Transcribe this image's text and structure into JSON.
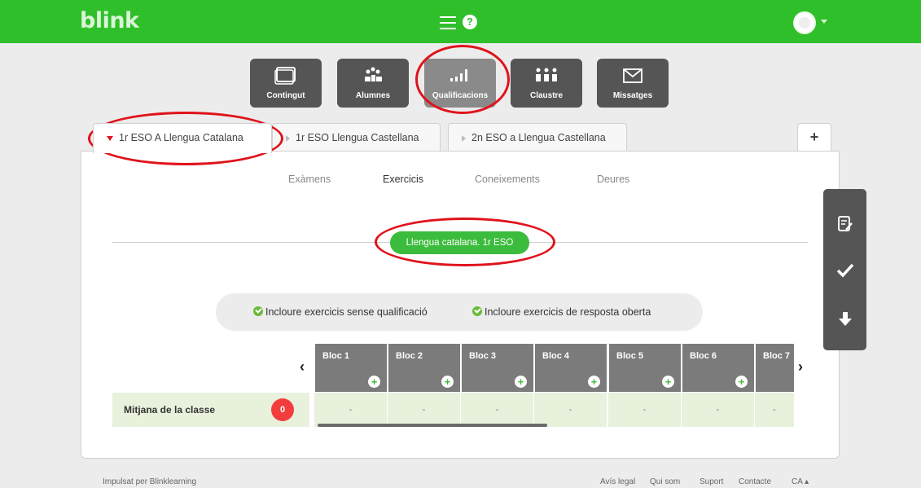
{
  "app": {
    "logo": "blink"
  },
  "modules": [
    {
      "label": "Contingut",
      "icon": "monitor-icon"
    },
    {
      "label": "Alumnes",
      "icon": "students-icon"
    },
    {
      "label": "Qualificacions",
      "icon": "bar-chart-icon",
      "active": true
    },
    {
      "label": "Claustre",
      "icon": "teachers-icon"
    },
    {
      "label": "Missatges",
      "icon": "envelope-icon"
    }
  ],
  "tabs": [
    {
      "label": "1r ESO A Llengua Catalana",
      "active": true
    },
    {
      "label": "1r ESO Llengua Castellana"
    },
    {
      "label": "2n ESO a Llengua Castellana"
    }
  ],
  "tab_add_label": "+",
  "subtabs": [
    {
      "label": "Exàmens"
    },
    {
      "label": "Exercicis",
      "active": true
    },
    {
      "label": "Coneixements"
    },
    {
      "label": "Deures"
    }
  ],
  "course_pill": "Llengua catalana. 1r ESO",
  "filters": [
    {
      "label": "Incloure exercicis sense qualificació",
      "checked": true
    },
    {
      "label": "Incloure exercicis de resposta oberta",
      "checked": true
    }
  ],
  "grid": {
    "blocs": [
      "Bloc 1",
      "Bloc 2",
      "Bloc 3",
      "Bloc 4",
      "Bloc 5",
      "Bloc 6",
      "Bloc 7"
    ],
    "row_label": "Mitjana de la classe",
    "row_badge": "0",
    "cells": [
      "-",
      "-",
      "-",
      "-",
      "-",
      "-",
      "-"
    ],
    "prev_arrow": "‹",
    "next_arrow": "›",
    "plus": "+"
  },
  "side_toolbar": [
    {
      "icon": "edit-note-icon"
    },
    {
      "icon": "checkmark-icon"
    },
    {
      "icon": "download-arrow-icon"
    }
  ],
  "footer": {
    "powered_by": "Impulsat per Blinklearning",
    "links": [
      "Avís legal",
      "Qui som",
      "Suport",
      "Contacte",
      "CA ▴"
    ]
  },
  "colors": {
    "brand_green": "#2fbf2a",
    "pill_green": "#3cbc3c",
    "annotation_red": "#e0121b",
    "badge_red": "#f33d3d"
  }
}
